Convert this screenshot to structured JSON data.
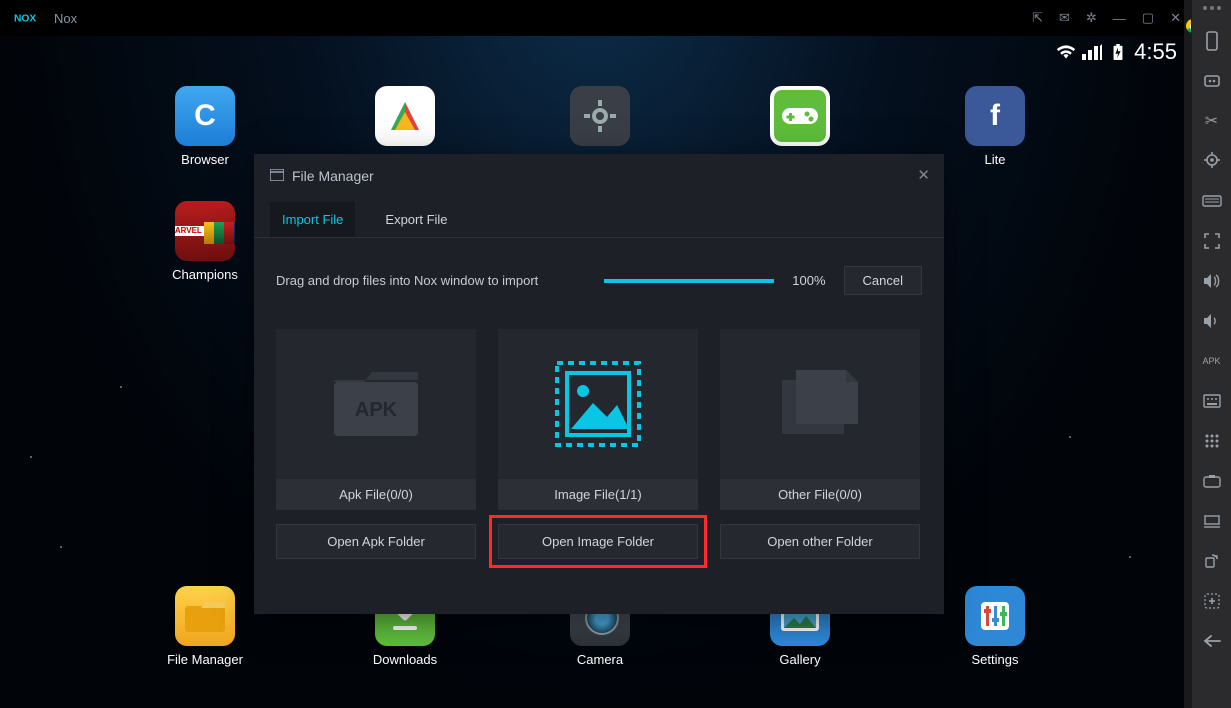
{
  "app": {
    "name": "Nox"
  },
  "statusbar": {
    "time": "4:55"
  },
  "desktop": {
    "row1": [
      {
        "label": "Browser"
      },
      {
        "label": ""
      },
      {
        "label": ""
      },
      {
        "label": ""
      },
      {
        "label": "Lite"
      }
    ],
    "champions_label": "Champions",
    "row2": [
      {
        "label": "File Manager"
      },
      {
        "label": "Downloads"
      },
      {
        "label": "Camera"
      },
      {
        "label": "Gallery"
      },
      {
        "label": "Settings"
      }
    ]
  },
  "dialog": {
    "title": "File Manager",
    "tabs": {
      "import": "Import File",
      "export": "Export File"
    },
    "instruction": "Drag and drop files into Nox window to import",
    "progress_pct": "100%",
    "cancel": "Cancel",
    "cards": {
      "apk": {
        "label": "Apk File(0/0)",
        "open": "Open Apk Folder"
      },
      "image": {
        "label": "Image File(1/1)",
        "open": "Open Image Folder"
      },
      "other": {
        "label": "Other File(0/0)",
        "open": "Open other Folder"
      }
    }
  },
  "sidebar": {
    "items": [
      "device",
      "assistant",
      "scissors",
      "location",
      "keyboard",
      "fullscreen",
      "volume-up",
      "volume-down",
      "apk",
      "kb-icon",
      "controller",
      "screenshot",
      "folder",
      "rotate",
      "plus",
      "back"
    ]
  }
}
